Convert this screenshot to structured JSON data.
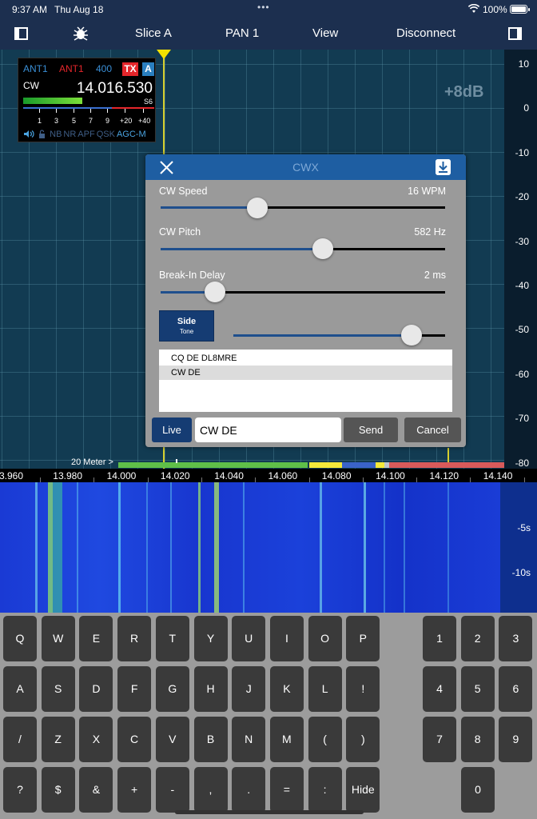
{
  "status": {
    "time": "9:37 AM",
    "date": "Thu Aug 18",
    "dots": "•••",
    "battery": "100%",
    "battery_level": 1.0
  },
  "nav": {
    "slice": "Slice A",
    "pan": "PAN 1",
    "view": "View",
    "disconnect": "Disconnect"
  },
  "pan": {
    "gain": "+8dB",
    "y_ticks": [
      "10",
      "0",
      "-10",
      "-20",
      "-30",
      "-40",
      "-50",
      "-60",
      "-70",
      "-80"
    ],
    "band_label": "20 Meter >"
  },
  "slice_flag": {
    "rx_ant": "ANT1",
    "tx_ant": "ANT1",
    "filter": "400",
    "tx": "TX",
    "letter": "A",
    "mode": "CW",
    "frequency": "14.016.530",
    "s_value": "S6",
    "s_level": 0.45,
    "scale": [
      "1",
      "3",
      "5",
      "7",
      "9",
      "+20",
      "+40"
    ],
    "features": [
      "NB",
      "NR",
      "APF",
      "QSK",
      "AGC-M"
    ]
  },
  "cwx": {
    "title": "CWX",
    "speed": {
      "label": "CW Speed",
      "value": "16 WPM",
      "level": 0.34
    },
    "pitch": {
      "label": "CW Pitch",
      "value": "582 Hz",
      "level": 0.57
    },
    "delay": {
      "label": "Break-In Delay",
      "value": "2 ms",
      "level": 0.19
    },
    "side": {
      "line1": "Side",
      "line2": "Tone",
      "level": 0.84
    },
    "macros": [
      "CQ DE DL8MRE",
      "CW DE"
    ],
    "live": "Live",
    "input_value": "CW DE",
    "send": "Send",
    "cancel": "Cancel"
  },
  "freq_scale": [
    "3.960",
    "13.980",
    "14.000",
    "14.020",
    "14.040",
    "14.060",
    "14.080",
    "14.100",
    "14.120",
    "14.140"
  ],
  "waterfall_times": [
    "-5s",
    "-10s"
  ],
  "keyboard": {
    "row1": [
      "Q",
      "W",
      "E",
      "R",
      "T",
      "Y",
      "U",
      "I",
      "O",
      "P"
    ],
    "row2": [
      "A",
      "S",
      "D",
      "F",
      "G",
      "H",
      "J",
      "K",
      "L",
      "!"
    ],
    "row3": [
      "/",
      "Z",
      "X",
      "C",
      "V",
      "B",
      "N",
      "M",
      "(",
      ")"
    ],
    "row4": [
      "?",
      "$",
      "&",
      "+",
      "-",
      ",",
      ".",
      "=",
      ":",
      "Hide"
    ],
    "numpad": [
      "1",
      "2",
      "3",
      "4",
      "5",
      "6",
      "7",
      "8",
      "9",
      "0"
    ]
  }
}
